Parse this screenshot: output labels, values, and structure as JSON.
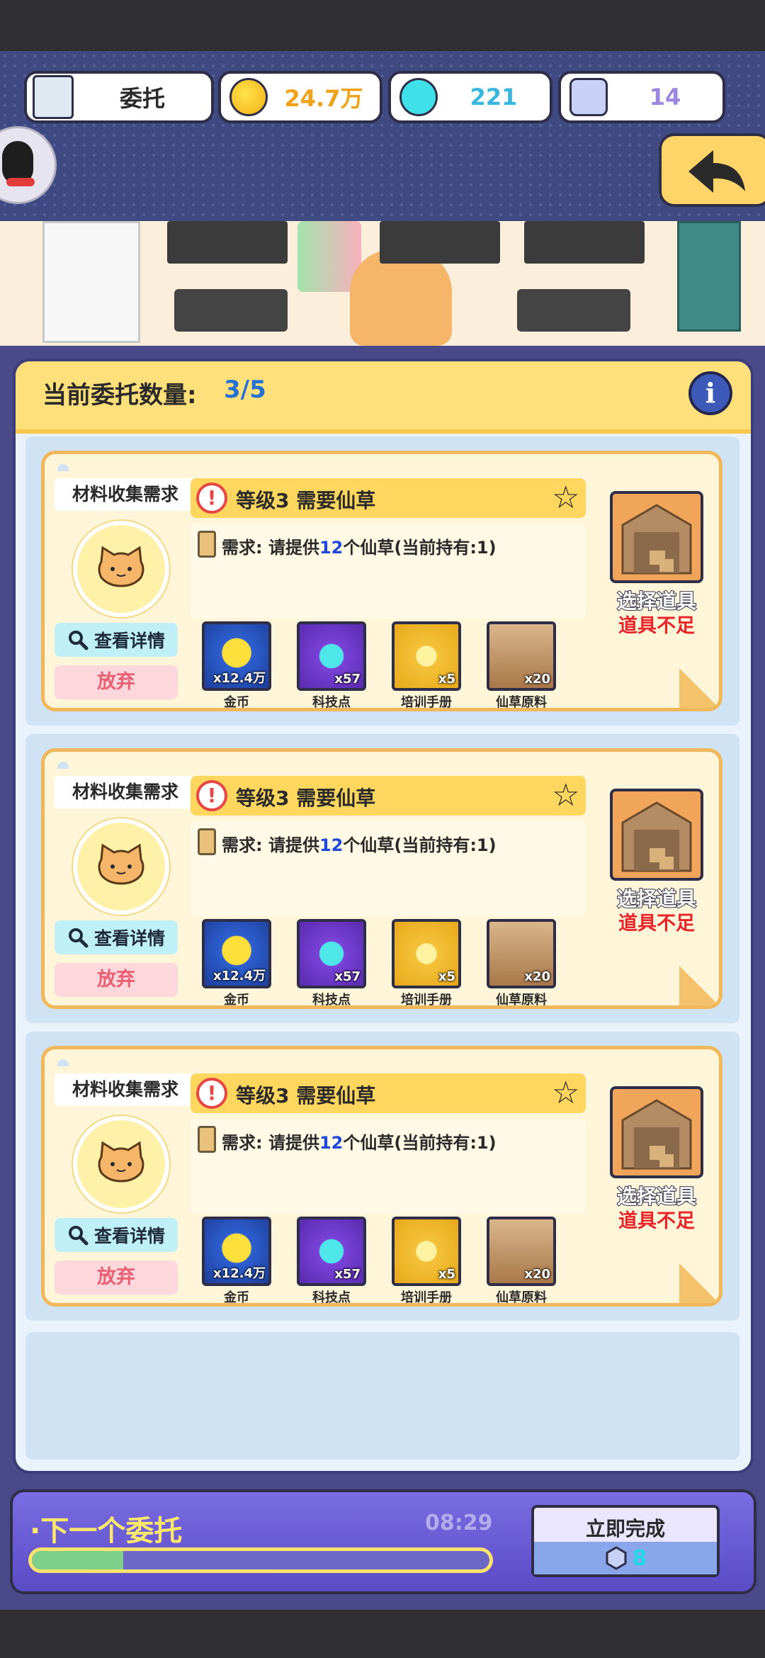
{
  "hud": {
    "title": "委托",
    "coins": "24.7万",
    "tech_points": "221",
    "gems": "14"
  },
  "panel": {
    "count_label": "当前委托数量:",
    "count_value": "3/5"
  },
  "cards": [
    {
      "tag": "材料收集需求",
      "title": "等级3 需要仙草",
      "req_prefix": "需求:  请提供",
      "req_num": "12",
      "req_suffix": "个仙草(当前持有:1)",
      "detail_label": "查看详情",
      "abandon_label": "放弃",
      "select_label": "选择道具",
      "insufficient_label": "道具不足",
      "rewards": [
        {
          "label": "金币",
          "qty": "x12.4万",
          "icon": "coin-icon"
        },
        {
          "label": "科技点",
          "qty": "x57",
          "icon": "flask-icon"
        },
        {
          "label": "培训手册",
          "qty": "x5",
          "icon": "manual-icon"
        },
        {
          "label": "仙草原料",
          "qty": "x20",
          "icon": "herb-crate-icon"
        }
      ]
    },
    {
      "tag": "材料收集需求",
      "title": "等级3 需要仙草",
      "req_prefix": "需求:  请提供",
      "req_num": "12",
      "req_suffix": "个仙草(当前持有:1)",
      "detail_label": "查看详情",
      "abandon_label": "放弃",
      "select_label": "选择道具",
      "insufficient_label": "道具不足",
      "rewards": [
        {
          "label": "金币",
          "qty": "x12.4万",
          "icon": "coin-icon"
        },
        {
          "label": "科技点",
          "qty": "x57",
          "icon": "flask-icon"
        },
        {
          "label": "培训手册",
          "qty": "x5",
          "icon": "manual-icon"
        },
        {
          "label": "仙草原料",
          "qty": "x20",
          "icon": "herb-crate-icon"
        }
      ]
    },
    {
      "tag": "材料收集需求",
      "title": "等级3 需要仙草",
      "req_prefix": "需求:  请提供",
      "req_num": "12",
      "req_suffix": "个仙草(当前持有:1)",
      "detail_label": "查看详情",
      "abandon_label": "放弃",
      "select_label": "选择道具",
      "insufficient_label": "道具不足",
      "rewards": [
        {
          "label": "金币",
          "qty": "x12.4万",
          "icon": "coin-icon"
        },
        {
          "label": "科技点",
          "qty": "x57",
          "icon": "flask-icon"
        },
        {
          "label": "培训手册",
          "qty": "x5",
          "icon": "manual-icon"
        },
        {
          "label": "仙草原料",
          "qty": "x20",
          "icon": "herb-crate-icon"
        }
      ]
    }
  ],
  "bottom": {
    "next_label": "·下一个委托",
    "timer": "08:29",
    "progress": 0.2,
    "finish_label": "立即完成",
    "finish_cost": "8"
  },
  "colors": {
    "accent_yellow": "#ffd75e",
    "card_border": "#f0b85a",
    "warning_red": "#e8242a",
    "link_blue": "#2048d6"
  }
}
